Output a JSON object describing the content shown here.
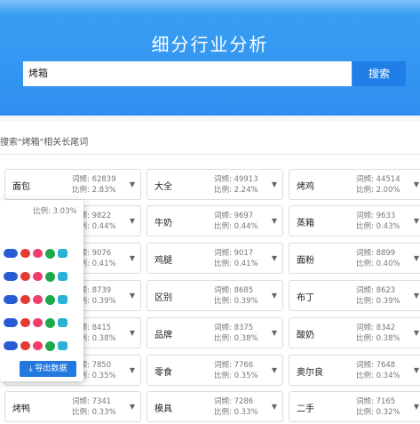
{
  "header": {
    "title": "细分行业分析",
    "search_value": "烤箱",
    "search_button": "搜索"
  },
  "section": {
    "subtitle": "搜索\"烤箱\"相关长尾词"
  },
  "cards": [
    {
      "keyword": "面包",
      "freq": "词频: 62839",
      "ratio": "比例: 2.83%"
    },
    {
      "keyword": "大全",
      "freq": "词频: 49913",
      "ratio": "比例: 2.24%"
    },
    {
      "keyword": "烤鸡",
      "freq": "词频: 44514",
      "ratio": "比例: 2.00%"
    },
    {
      "keyword": "",
      "freq": "词频: 9822",
      "ratio": "比例: 0.44%"
    },
    {
      "keyword": "牛奶",
      "freq": "词频: 9697",
      "ratio": "比例: 0.44%"
    },
    {
      "keyword": "蒸箱",
      "freq": "词频: 9633",
      "ratio": "比例: 0.43%"
    },
    {
      "keyword": "",
      "freq": "词频: 9076",
      "ratio": "比例: 0.41%"
    },
    {
      "keyword": "鸡腿",
      "freq": "词频: 9017",
      "ratio": "比例: 0.41%"
    },
    {
      "keyword": "面粉",
      "freq": "词频: 8899",
      "ratio": "比例: 0.40%"
    },
    {
      "keyword": "",
      "freq": "词频: 8739",
      "ratio": "比例: 0.39%"
    },
    {
      "keyword": "区别",
      "freq": "词频: 8685",
      "ratio": "比例: 0.39%"
    },
    {
      "keyword": "布丁",
      "freq": "词频: 8623",
      "ratio": "比例: 0.39%"
    },
    {
      "keyword": "",
      "freq": "词频: 8415",
      "ratio": "比例: 0.38%"
    },
    {
      "keyword": "品牌",
      "freq": "词频: 8375",
      "ratio": "比例: 0.38%"
    },
    {
      "keyword": "酸奶",
      "freq": "词频: 8342",
      "ratio": "比例: 0.38%"
    },
    {
      "keyword": "",
      "freq": "词频: 7850",
      "ratio": "比例: 0.35%"
    },
    {
      "keyword": "零食",
      "freq": "词频: 7766",
      "ratio": "比例: 0.35%"
    },
    {
      "keyword": "奥尔良",
      "freq": "词频: 7648",
      "ratio": "比例: 0.34%"
    },
    {
      "keyword": "烤鸭",
      "freq": "词频: 7341",
      "ratio": "比例: 0.33%"
    },
    {
      "keyword": "模具",
      "freq": "词频: 7286",
      "ratio": "比例: 0.33%"
    },
    {
      "keyword": "二手",
      "freq": "词频: 7165",
      "ratio": "比例: 0.32%"
    }
  ],
  "popup": {
    "ratio": "比例: 3.03%",
    "export_label": "导出数据",
    "icons": [
      "baidu-icon",
      "weibo-icon",
      "taobao-icon",
      "wechat-icon",
      "zhihu-icon"
    ]
  },
  "colors": {
    "header_blue": "#2f8ff0",
    "button_blue": "#1f7fe6"
  }
}
